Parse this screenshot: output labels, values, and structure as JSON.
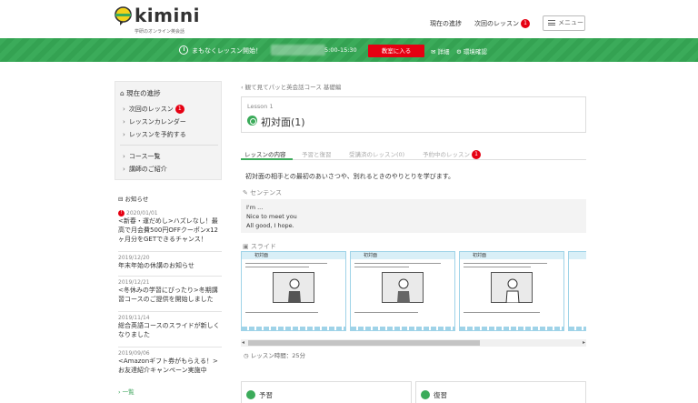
{
  "header": {
    "logo_text": "kimini",
    "logo_tagline": "学研のオンライン英会話",
    "nav_current": "現在の進捗",
    "nav_next": "次回のレッスン",
    "nav_next_badge": "1",
    "menu_label": "メニュー"
  },
  "banner": {
    "message": "まもなくレッスン開始！",
    "time": "5:00-15:30",
    "enter_button": "教室に入る",
    "detail": "詳細",
    "env_check": "環境確認",
    "color": "#3bab5a"
  },
  "sidebar": {
    "title": "現在の進捗",
    "items": [
      {
        "label": "次回のレッスン",
        "badge": "1"
      },
      {
        "label": "レッスンカレンダー"
      },
      {
        "label": "レッスンを予約する"
      },
      {
        "label": "コース一覧"
      },
      {
        "label": "講師のご紹介"
      }
    ]
  },
  "news": {
    "title": "お知らせ",
    "items": [
      {
        "date": "2020/01/01",
        "text": "<新春・運だめし>ハズレなし！最高で月会費500円OFFクーポンx12ヶ月分をGETできるチャンス！",
        "is_new": true
      },
      {
        "date": "2019/12/20",
        "text": "年末年始の休講のお知らせ"
      },
      {
        "date": "2019/12/21",
        "text": "<冬休みの学習にぴったり>冬期講習コースのご提供を開始しました"
      },
      {
        "date": "2019/11/14",
        "text": "総合英語コースのスライドが新しくなりました"
      },
      {
        "date": "2019/09/06",
        "text": "<Amazonギフト券がもらえる！>お友達紹介キャンペーン実施中"
      }
    ],
    "more": "一覧"
  },
  "main": {
    "breadcrumb": "観て見てパッと英会話コース 基礎編",
    "lesson_number": "Lesson 1",
    "lesson_title": "初対面(1)",
    "tabs": [
      {
        "label": "レッスンの内容",
        "active": true
      },
      {
        "label": "予習と復習"
      },
      {
        "label": "受講済のレッスン(0)"
      },
      {
        "label": "予約中のレッスン",
        "badge": "1"
      }
    ],
    "description": "初対面の相手との最初のあいさつや、別れるときのやりとりを学びます。",
    "sentence_label": "センテンス",
    "sentences": [
      "I'm ...",
      "Nice to meet you",
      "All good, I hope."
    ],
    "slide_label": "スライド",
    "slides": [
      {
        "head": "初対面"
      },
      {
        "head": "初対面"
      },
      {
        "head": "初対面"
      }
    ],
    "duration": "レッスン時間：25分",
    "preview_label": "予習",
    "review_label": "復習"
  }
}
